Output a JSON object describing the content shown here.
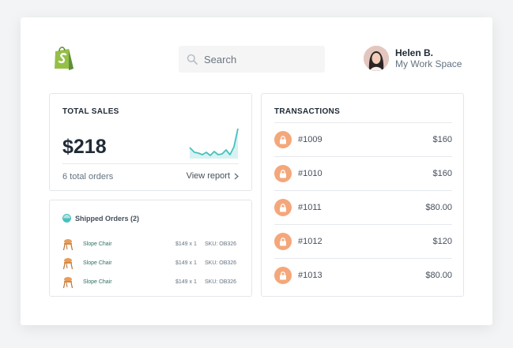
{
  "header": {
    "search_placeholder": "Search",
    "user_name": "Helen B.",
    "user_workspace": "My Work Space"
  },
  "sales": {
    "title": "TOTAL SALES",
    "amount": "$218",
    "orders": "6 total orders",
    "view_report": "View report"
  },
  "shipped": {
    "title": "Shipped Orders (2)",
    "items": [
      {
        "name": "Slope Chair",
        "price_qty": "$149 x 1",
        "sku": "SKU: OB326"
      },
      {
        "name": "Slope Chair",
        "price_qty": "$149 x 1",
        "sku": "SKU: OB326"
      },
      {
        "name": "Slope Chair",
        "price_qty": "$149 x 1",
        "sku": "SKU: OB326"
      }
    ]
  },
  "transactions": {
    "title": "TRANSACTIONS",
    "rows": [
      {
        "id": "#1009",
        "amount": "$160"
      },
      {
        "id": "#1010",
        "amount": "$160"
      },
      {
        "id": "#1011",
        "amount": "$80.00"
      },
      {
        "id": "#1012",
        "amount": "$120"
      },
      {
        "id": "#1013",
        "amount": "$80.00"
      }
    ]
  },
  "colors": {
    "brand_green": "#95bf47",
    "accent_teal": "#47c1bf",
    "lock_orange": "#f4a77a"
  }
}
